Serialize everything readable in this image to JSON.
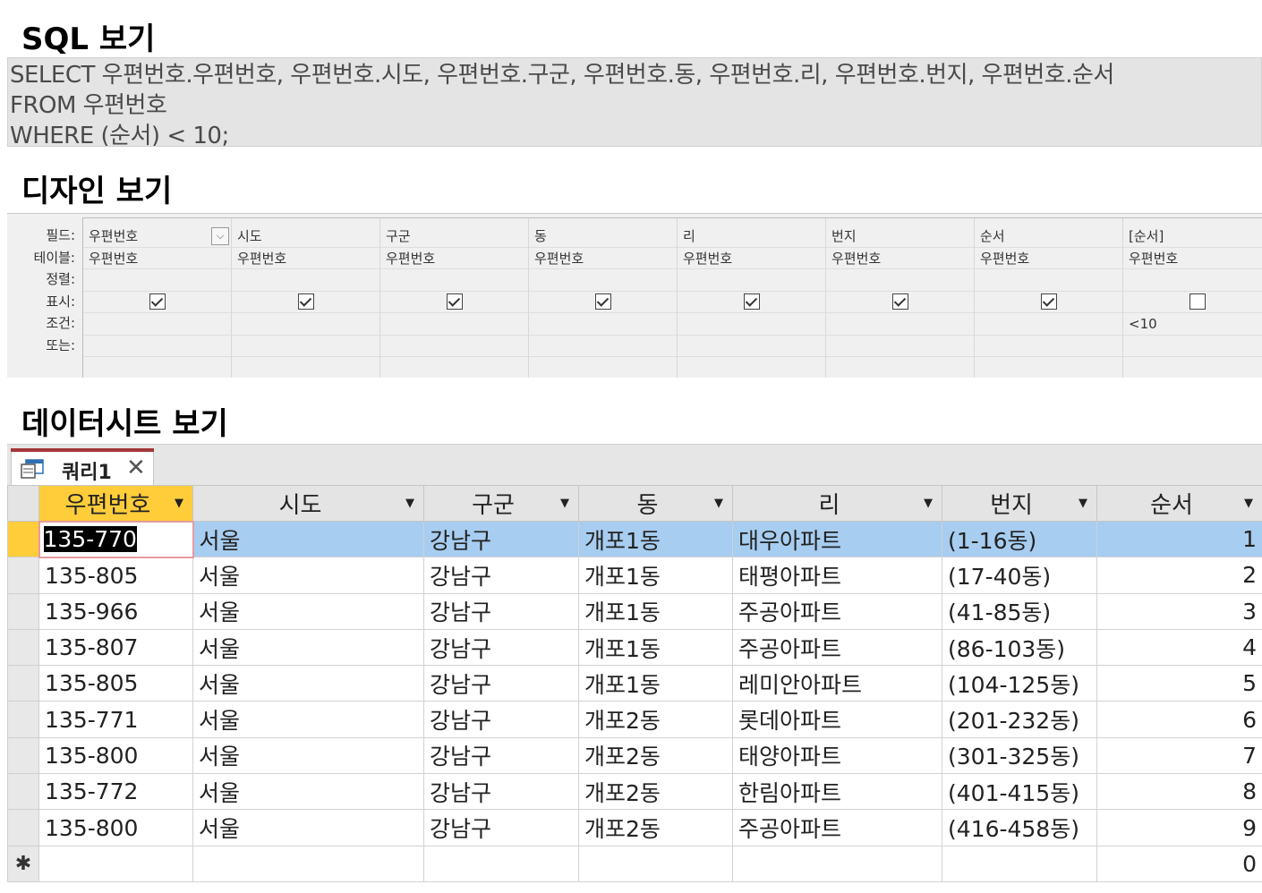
{
  "sql_view": {
    "title": "SQL 보기",
    "lines": [
      "SELECT 우편번호.우편번호, 우편번호.시도, 우편번호.구군, 우편번호.동, 우편번호.리, 우편번호.번지, 우편번호.순서",
      "FROM 우편번호",
      "WHERE (순서) < 10;"
    ]
  },
  "design_view": {
    "title": "디자인 보기",
    "row_labels": [
      "필드:",
      "테이블:",
      "정렬:",
      "표시:",
      "조건:",
      "또는:"
    ],
    "columns": [
      {
        "field": "우편번호",
        "table": "우편번호",
        "sort": "",
        "show": true,
        "criteria": "",
        "or": ""
      },
      {
        "field": "시도",
        "table": "우편번호",
        "sort": "",
        "show": true,
        "criteria": "",
        "or": ""
      },
      {
        "field": "구군",
        "table": "우편번호",
        "sort": "",
        "show": true,
        "criteria": "",
        "or": ""
      },
      {
        "field": "동",
        "table": "우편번호",
        "sort": "",
        "show": true,
        "criteria": "",
        "or": ""
      },
      {
        "field": "리",
        "table": "우편번호",
        "sort": "",
        "show": true,
        "criteria": "",
        "or": ""
      },
      {
        "field": "번지",
        "table": "우편번호",
        "sort": "",
        "show": true,
        "criteria": "",
        "or": ""
      },
      {
        "field": "순서",
        "table": "우편번호",
        "sort": "",
        "show": true,
        "criteria": "",
        "or": ""
      },
      {
        "field": "[순서]",
        "table": "우편번호",
        "sort": "",
        "show": false,
        "criteria": "<10",
        "or": ""
      }
    ]
  },
  "datasheet_view": {
    "title": "데이터시트 보기",
    "tab_label": "쿼리1",
    "close_glyph": "✕",
    "new_row_marker": "✱",
    "headers": [
      "우편번호",
      "시도",
      "구군",
      "동",
      "리",
      "번지",
      "순서"
    ],
    "rows": [
      [
        "135-770",
        "서울",
        "강남구",
        "개포1동",
        "대우아파트",
        "(1-16동)",
        "1"
      ],
      [
        "135-805",
        "서울",
        "강남구",
        "개포1동",
        "태평아파트",
        "(17-40동)",
        "2"
      ],
      [
        "135-966",
        "서울",
        "강남구",
        "개포1동",
        "주공아파트",
        "(41-85동)",
        "3"
      ],
      [
        "135-807",
        "서울",
        "강남구",
        "개포1동",
        "주공아파트",
        "(86-103동)",
        "4"
      ],
      [
        "135-805",
        "서울",
        "강남구",
        "개포1동",
        "레미안아파트",
        "(104-125동)",
        "5"
      ],
      [
        "135-771",
        "서울",
        "강남구",
        "개포2동",
        "롯데아파트",
        "(201-232동)",
        "6"
      ],
      [
        "135-800",
        "서울",
        "강남구",
        "개포2동",
        "태양아파트",
        "(301-325동)",
        "7"
      ],
      [
        "135-772",
        "서울",
        "강남구",
        "개포2동",
        "한림아파트",
        "(401-415동)",
        "8"
      ],
      [
        "135-800",
        "서울",
        "강남구",
        "개포2동",
        "주공아파트",
        "(416-458동)",
        "9"
      ]
    ],
    "new_row_default": "0",
    "colors": {
      "selected_row": "#a7cdf0",
      "selected_header": "#ffcd3a",
      "tab_accent": "#a4373a"
    }
  }
}
